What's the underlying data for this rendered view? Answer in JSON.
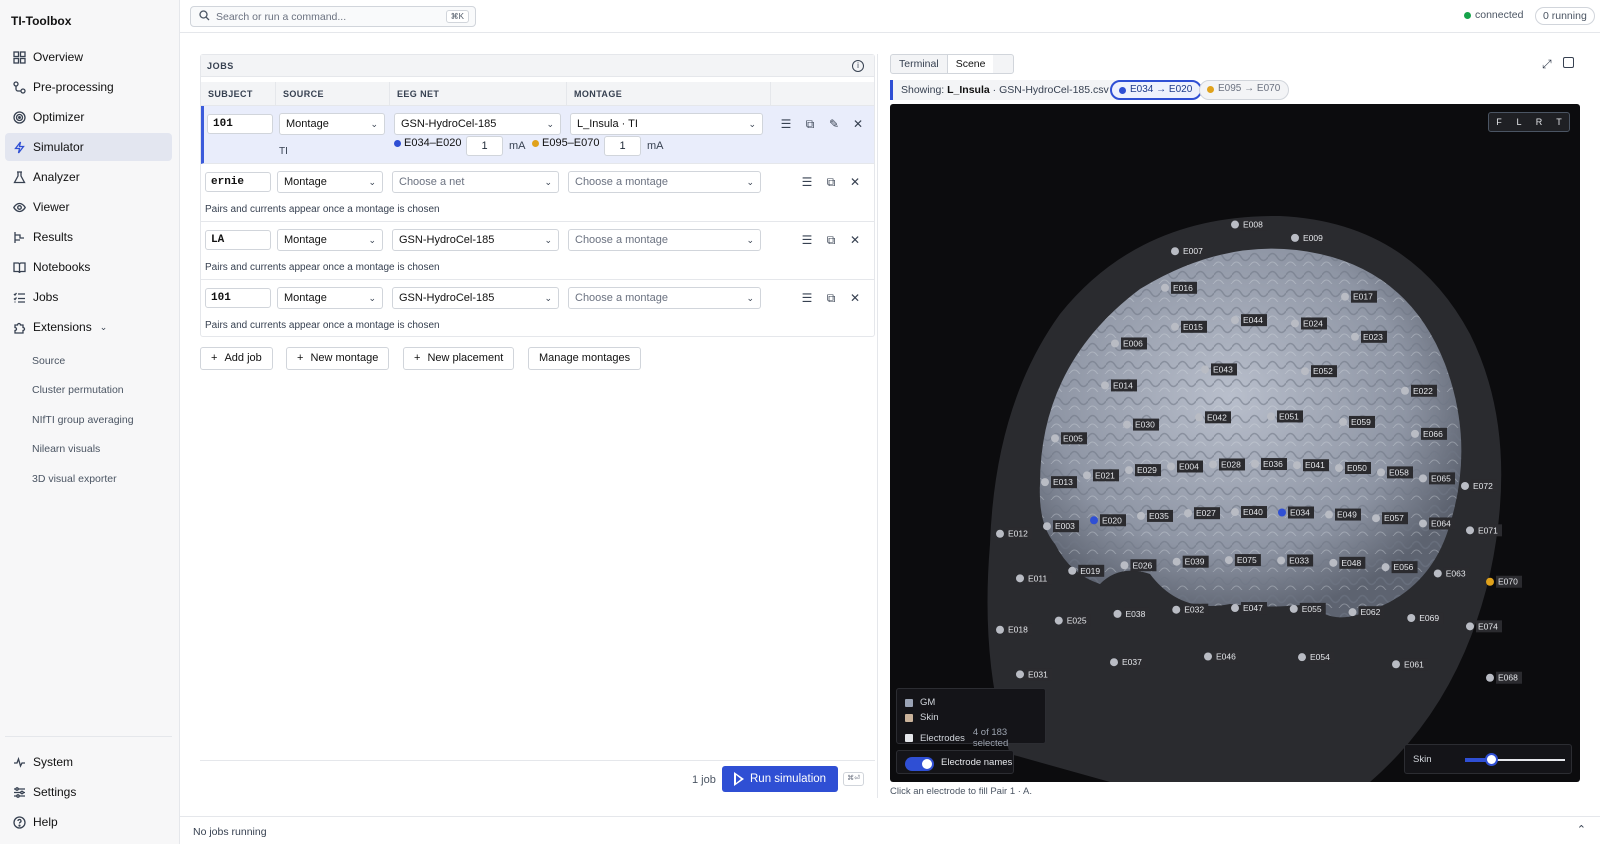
{
  "app": {
    "title": "TI-Toolbox"
  },
  "sidebar": {
    "items": [
      {
        "label": "Overview",
        "icon": "grid-icon"
      },
      {
        "label": "Pre-processing",
        "icon": "flow-icon"
      },
      {
        "label": "Optimizer",
        "icon": "target-icon"
      },
      {
        "label": "Simulator",
        "icon": "bolt-icon"
      },
      {
        "label": "Analyzer",
        "icon": "flask-icon"
      },
      {
        "label": "Viewer",
        "icon": "eye-icon"
      },
      {
        "label": "Results",
        "icon": "branch-icon"
      },
      {
        "label": "Notebooks",
        "icon": "book-icon"
      },
      {
        "label": "Jobs",
        "icon": "list-icon"
      },
      {
        "label": "Extensions",
        "icon": "puzzle-icon"
      }
    ],
    "active": "Simulator",
    "extensions": [
      "Source",
      "Cluster permutation",
      "NIfTI group averaging",
      "Nilearn visuals",
      "3D visual exporter"
    ],
    "bottom": [
      {
        "label": "System",
        "icon": "pulse-icon"
      },
      {
        "label": "Settings",
        "icon": "sliders-icon"
      },
      {
        "label": "Help",
        "icon": "help-icon"
      }
    ]
  },
  "topbar": {
    "search_placeholder": "Search or run a command...",
    "search_kbd": "⌘K",
    "connection": "connected",
    "running": "0 running"
  },
  "jobs": {
    "title": "JOBS",
    "columns": [
      "SUBJECT",
      "SOURCE",
      "EEG NET",
      "MONTAGE"
    ],
    "hint": "Pairs and currents appear once a montage is chosen",
    "rows": [
      {
        "subject": "101",
        "source": "Montage",
        "net": "GSN-HydroCel-185",
        "montage": "L_Insula · TI",
        "type": "TI",
        "pairs": [
          {
            "label": "E034–E020",
            "current": "1",
            "unit": "mA",
            "color": "#2f4fd4"
          },
          {
            "label": "E095–E070",
            "current": "1",
            "unit": "mA",
            "color": "#e0a21b"
          }
        ]
      },
      {
        "subject": "ernie",
        "source": "Montage",
        "net": "Choose a net",
        "montage": "Choose a montage"
      },
      {
        "subject": "LA",
        "source": "Montage",
        "net": "GSN-HydroCel-185",
        "montage": "Choose a montage"
      },
      {
        "subject": "101",
        "source": "Montage",
        "net": "GSN-HydroCel-185",
        "montage": "Choose a montage"
      }
    ],
    "buttons": {
      "add_job": "Add job",
      "new_montage": "New montage",
      "new_placement": "New placement",
      "manage_montages": "Manage montages"
    },
    "count": "1 job",
    "run": "Run simulation",
    "run_kbd": "⌘⏎"
  },
  "scene": {
    "tabs": [
      "Terminal",
      "Scene"
    ],
    "active_tab": "Scene",
    "showing_prefix": "Showing:",
    "showing_name": "L_Insula",
    "showing_file": "· GSN-HydroCel-185.csv",
    "chips": [
      {
        "label": "E034 → E020",
        "color": "#2f4fd4"
      },
      {
        "label": "E095 → E070",
        "color": "#e0a21b"
      }
    ],
    "views": [
      "F",
      "L",
      "R",
      "T"
    ],
    "legend": [
      {
        "label": "GM",
        "color": "#9aa3b5"
      },
      {
        "label": "Skin",
        "color": "#c9b29a"
      },
      {
        "label": "Electrodes",
        "color": "#e5e7eb",
        "count": "4 of 183 selected"
      }
    ],
    "toggle_label": "Electrode names",
    "skin_label": "Skin",
    "skin_opacity": 0.25,
    "hint": "Click an electrode to fill Pair 1 · A.",
    "electrodes": [
      "E007",
      "E008",
      "E009",
      "E016",
      "E017",
      "E006",
      "E015",
      "E044",
      "E024",
      "E023",
      "E014",
      "E043",
      "E052",
      "E022",
      "E005",
      "E030",
      "E042",
      "E051",
      "E059",
      "E066",
      "E013",
      "E021",
      "E029",
      "E004",
      "E028",
      "E036",
      "E041",
      "E050",
      "E058",
      "E065",
      "E072",
      "E012",
      "E003",
      "E020",
      "E035",
      "E027",
      "E040",
      "E034",
      "E049",
      "E057",
      "E064",
      "E071",
      "E011",
      "E019",
      "E026",
      "E039",
      "E075",
      "E033",
      "E048",
      "E056",
      "E063",
      "E070",
      "E018",
      "E025",
      "E038",
      "E032",
      "E047",
      "E055",
      "E062",
      "E069",
      "E074",
      "E031",
      "E037",
      "E046",
      "E054",
      "E061",
      "E068"
    ]
  },
  "status": {
    "text": "No jobs running"
  }
}
